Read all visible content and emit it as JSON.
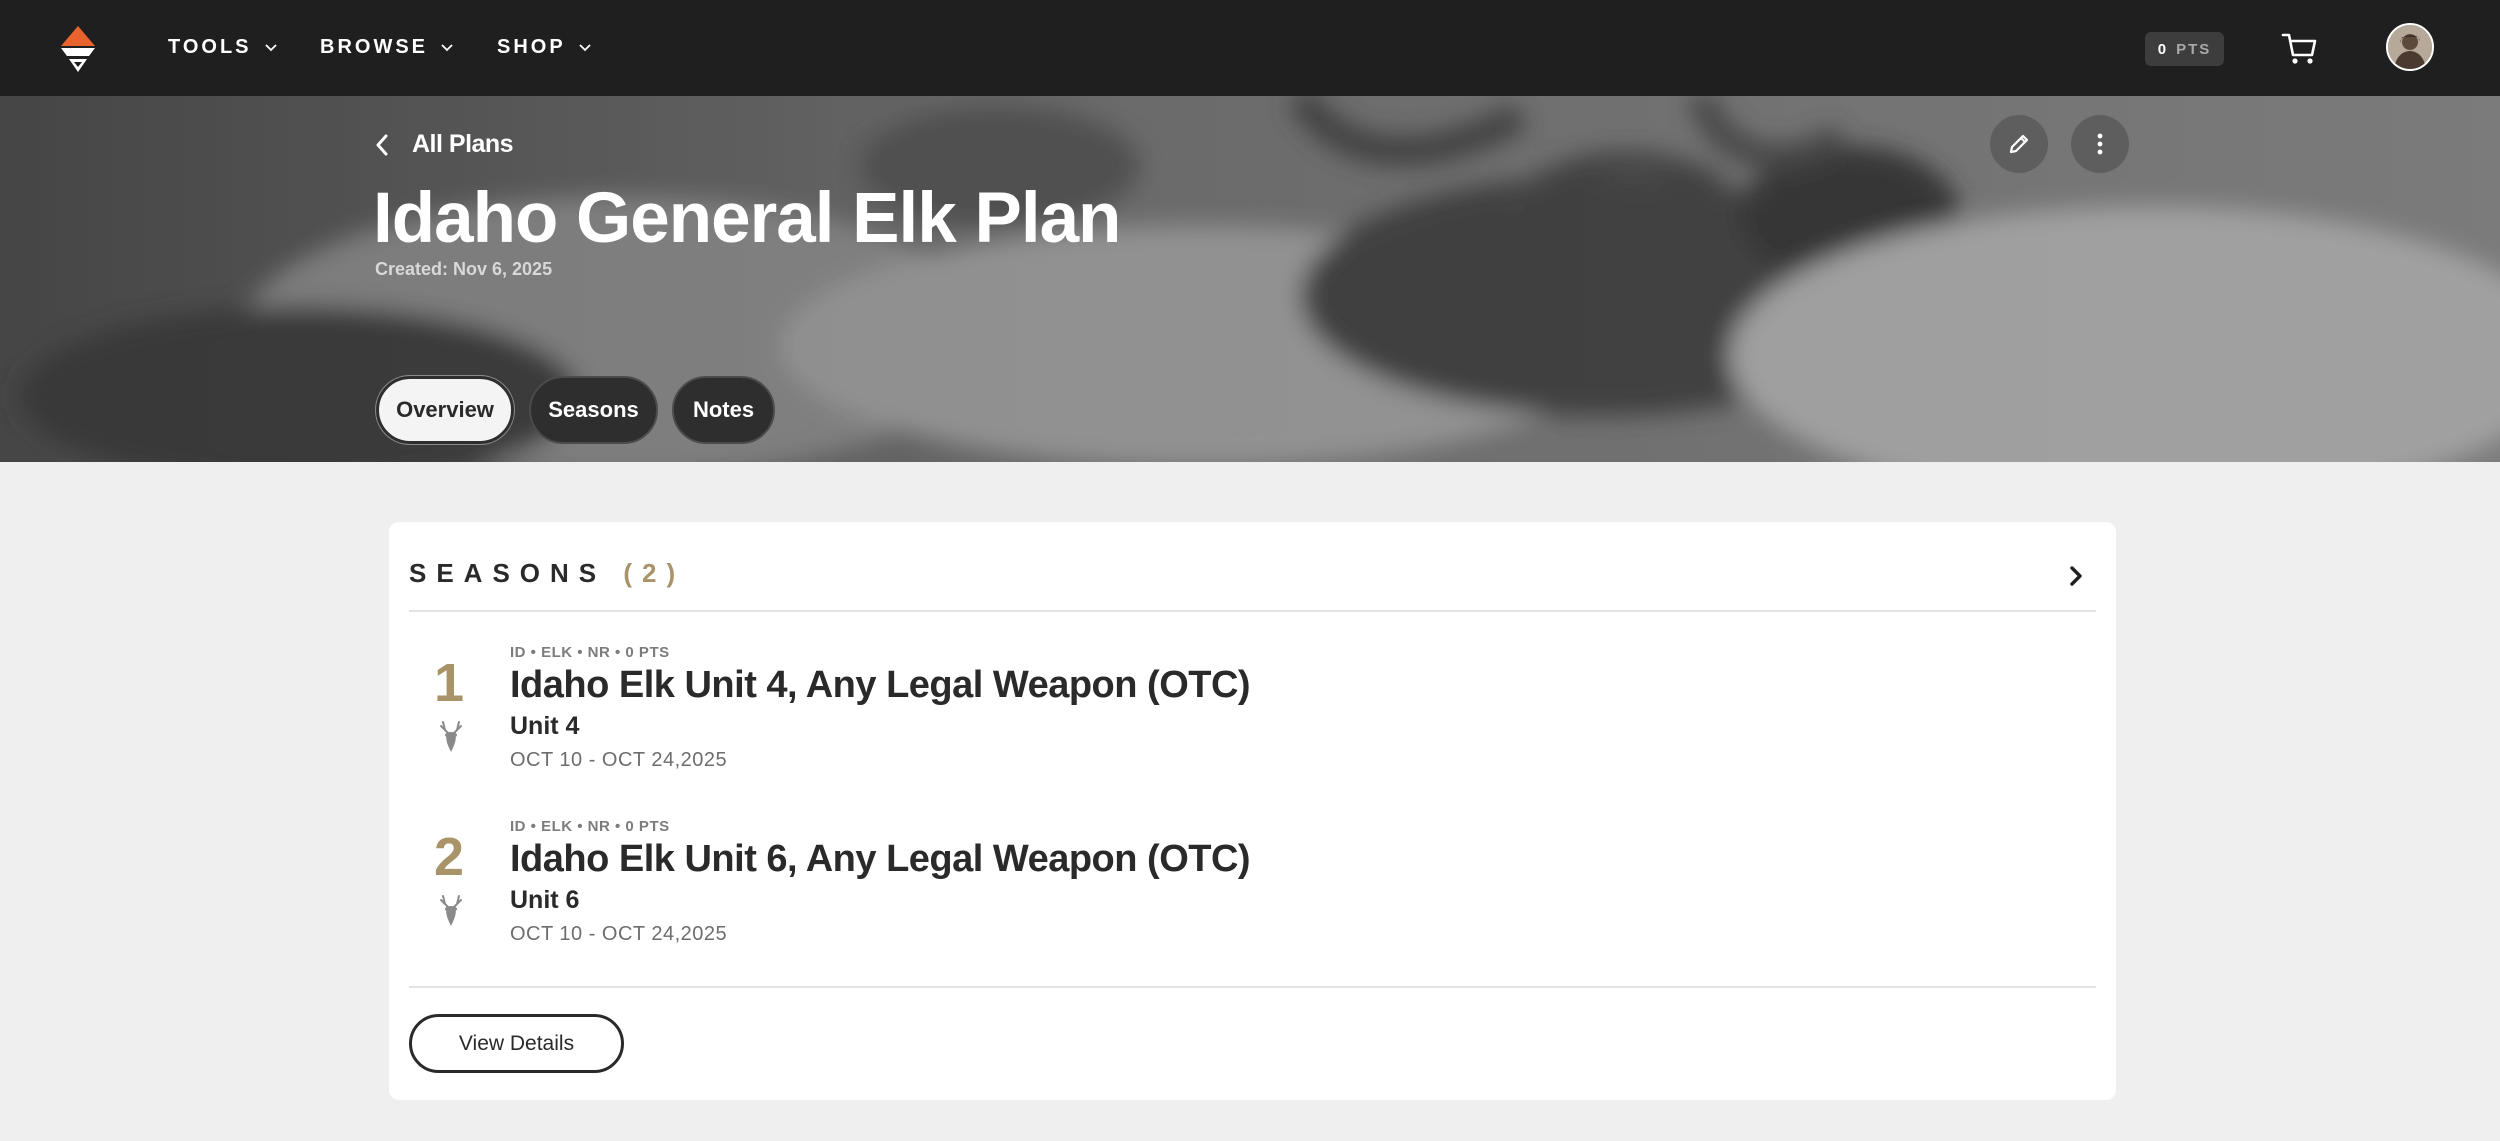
{
  "nav": {
    "items": [
      {
        "label": "TOOLS"
      },
      {
        "label": "BROWSE"
      },
      {
        "label": "SHOP"
      }
    ],
    "points": {
      "value": "0",
      "unit": "PTS"
    }
  },
  "hero": {
    "back_label": "All Plans",
    "title": "Idaho General Elk Plan",
    "created": "Created: Nov 6, 2025",
    "tabs": [
      {
        "label": "Overview",
        "active": true
      },
      {
        "label": "Seasons",
        "active": false
      },
      {
        "label": "Notes",
        "active": false
      }
    ]
  },
  "seasons_card": {
    "heading": "SEASONS",
    "count": "(2)",
    "seasons": [
      {
        "number": "1",
        "meta": "ID • ELK • NR • 0 PTS",
        "name": "Idaho Elk Unit 4, Any Legal Weapon (OTC)",
        "unit": "Unit 4",
        "dates": "OCT 10 - OCT 24,2025"
      },
      {
        "number": "2",
        "meta": "ID • ELK • NR • 0 PTS",
        "name": "Idaho Elk Unit 6, Any Legal Weapon (OTC)",
        "unit": "Unit 6",
        "dates": "OCT 10 - OCT 24,2025"
      }
    ],
    "view_details_label": "View Details"
  },
  "colors": {
    "nav_bg": "#1f1f1f",
    "accent_gold": "#a9946a",
    "logo_orange": "#e8642c",
    "page_bg": "#efefef"
  }
}
